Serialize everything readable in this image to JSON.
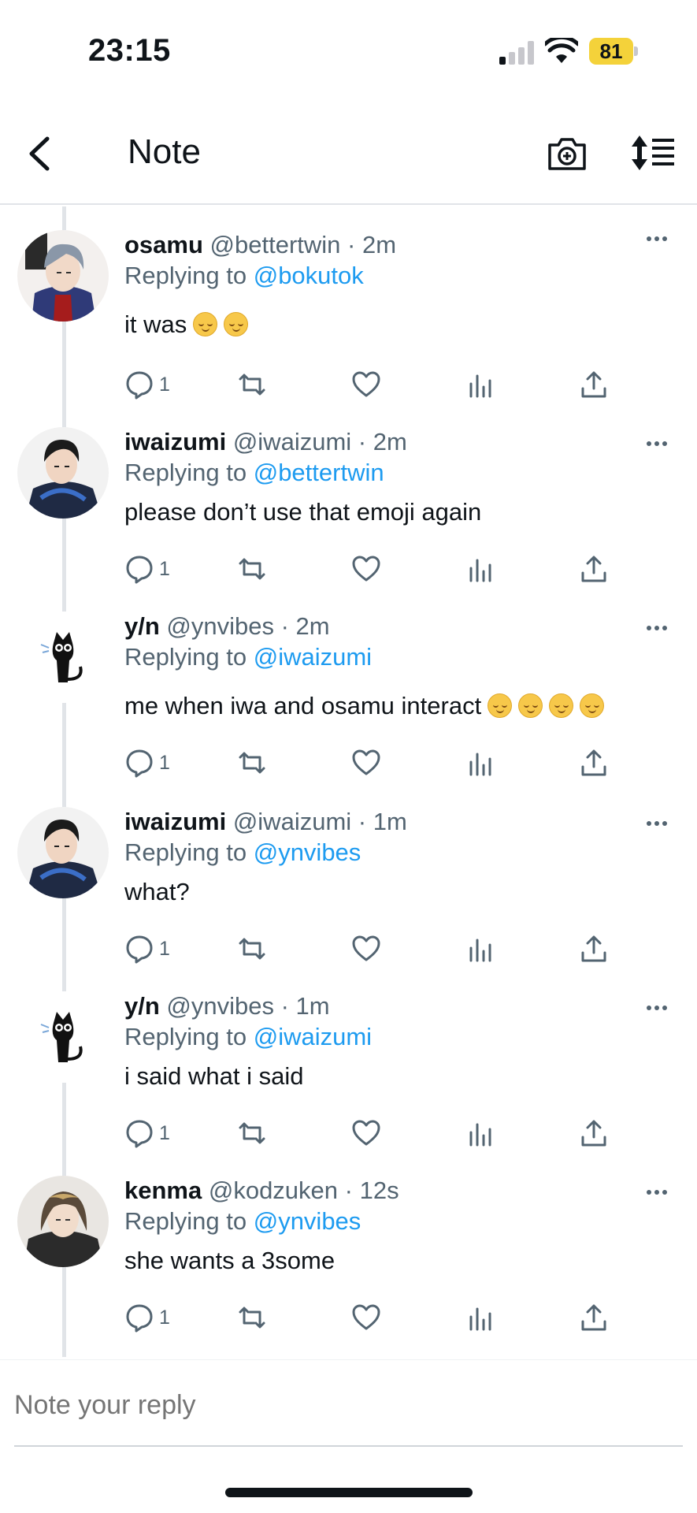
{
  "status_bar": {
    "time": "23:15",
    "battery": "81"
  },
  "header": {
    "title": "Note",
    "back_icon": "chevron-left-icon",
    "camera_icon": "camera-plus-icon",
    "sort_icon": "sort-icon"
  },
  "notes": [
    {
      "name": "osamu",
      "meta": "@bettertwin · 2m",
      "reply_prefix": "Replying to ",
      "reply_to": "@bokutok",
      "text": "it was",
      "emoji_count": 2,
      "reply_count": "1",
      "avatar": "grey-haired-character"
    },
    {
      "name": "iwaizumi",
      "meta": "@iwaizumi · 2m",
      "reply_prefix": "Replying to ",
      "reply_to": "@bettertwin",
      "text": "please don’t use that emoji again",
      "emoji_count": 0,
      "reply_count": "1",
      "avatar": "dark-haired-character"
    },
    {
      "name": "y/n",
      "meta": "@ynvibes · 2m",
      "reply_prefix": "Replying to ",
      "reply_to": "@iwaizumi",
      "text": "me when iwa and osamu interact",
      "emoji_count": 4,
      "reply_count": "1",
      "avatar": "black-cat"
    },
    {
      "name": "iwaizumi",
      "meta": "@iwaizumi · 1m",
      "reply_prefix": "Replying to ",
      "reply_to": "@ynvibes",
      "text": "what?",
      "emoji_count": 0,
      "reply_count": "1",
      "avatar": "dark-haired-character"
    },
    {
      "name": "y/n",
      "meta": "@ynvibes · 1m",
      "reply_prefix": "Replying to ",
      "reply_to": "@iwaizumi",
      "text": "i said what i said",
      "emoji_count": 0,
      "reply_count": "1",
      "avatar": "black-cat"
    },
    {
      "name": "kenma",
      "meta": "@kodzuken · 12s",
      "reply_prefix": "Replying to ",
      "reply_to": "@ynvibes",
      "text": "she wants a 3some",
      "emoji_count": 0,
      "reply_count": "1",
      "avatar": "blonde-haired-character"
    }
  ],
  "composer": {
    "placeholder": "Note your reply"
  },
  "colors": {
    "accent": "#1d9bf0",
    "muted": "#536471",
    "battery": "#f4d23a"
  }
}
